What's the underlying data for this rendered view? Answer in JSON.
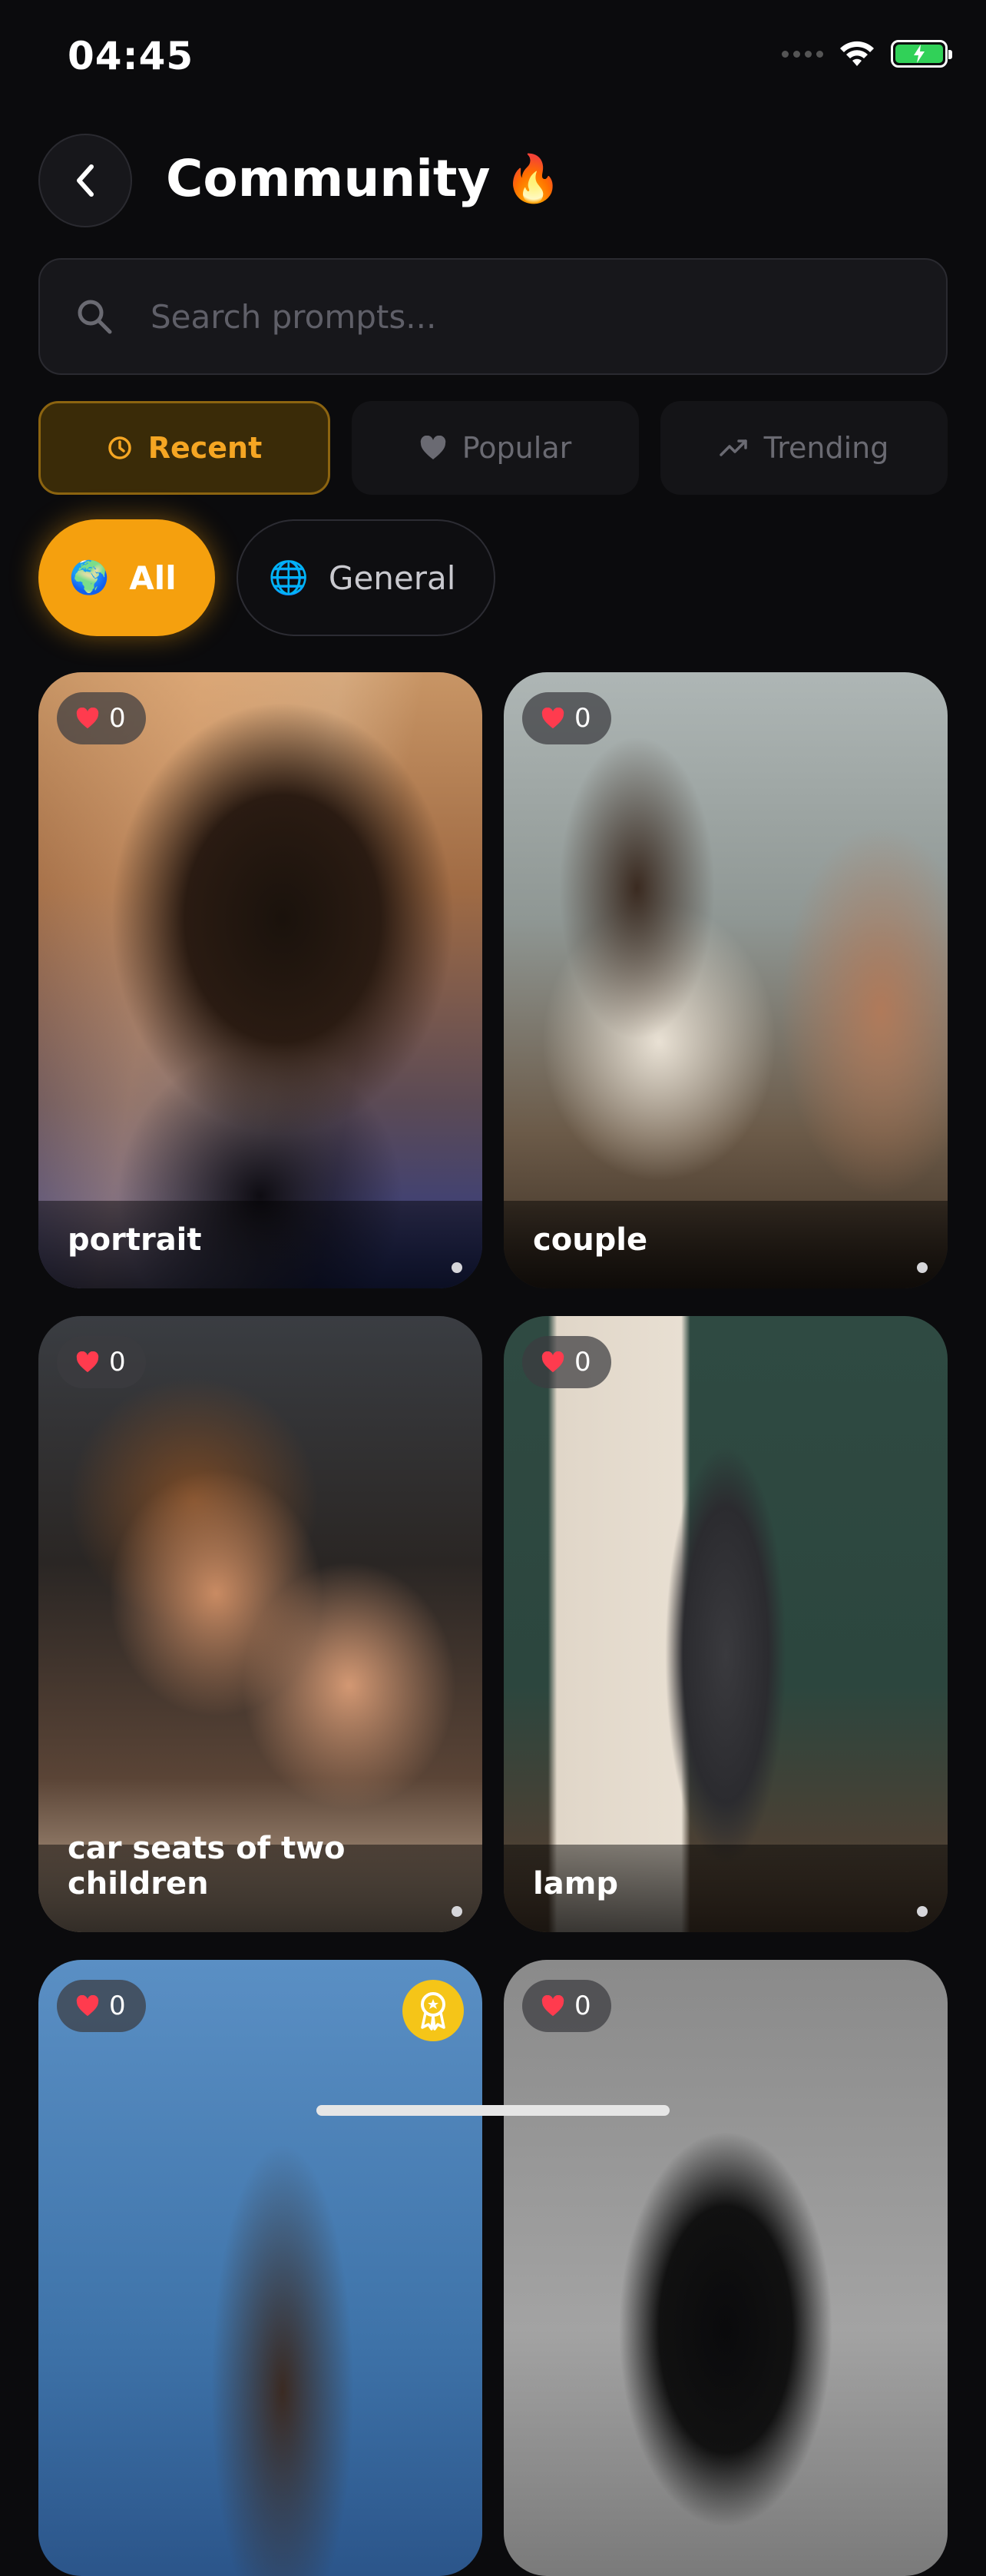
{
  "status_bar": {
    "time": "04:45",
    "battery_color": "#31d158"
  },
  "header": {
    "title": "Community",
    "title_emoji": "🔥"
  },
  "search": {
    "placeholder": "Search prompts..."
  },
  "sort_tabs": [
    {
      "label": "Recent",
      "icon": "clock-icon",
      "active": true
    },
    {
      "label": "Popular",
      "icon": "heart-icon",
      "active": false
    },
    {
      "label": "Trending",
      "icon": "trending-up-icon",
      "active": false
    }
  ],
  "category_chips": [
    {
      "label": "All",
      "emoji": "🌍",
      "active": true
    },
    {
      "label": "General",
      "emoji": "🌐",
      "active": false
    }
  ],
  "cards": [
    {
      "caption": "portrait",
      "likes": "0",
      "image": "blurred-portrait-of-man"
    },
    {
      "caption": "couple",
      "likes": "0",
      "image": "couple-at-kitchen-table"
    },
    {
      "caption": "car seats of two children",
      "likes": "0",
      "image": "two-children-sleeping-in-car"
    },
    {
      "caption": "lamp",
      "likes": "0",
      "image": "man-in-long-coat-with-lamp"
    },
    {
      "caption": "",
      "likes": "0",
      "image": "woman-hair-in-wind",
      "award": true
    },
    {
      "caption": "",
      "likes": "0",
      "image": "woman-with-bangs"
    }
  ],
  "colors": {
    "background": "#0b0b0d",
    "accent": "#f5a00e",
    "active_tab_text": "#f5a623",
    "like_heart": "#ff3b4e",
    "award": "#f5c518"
  }
}
